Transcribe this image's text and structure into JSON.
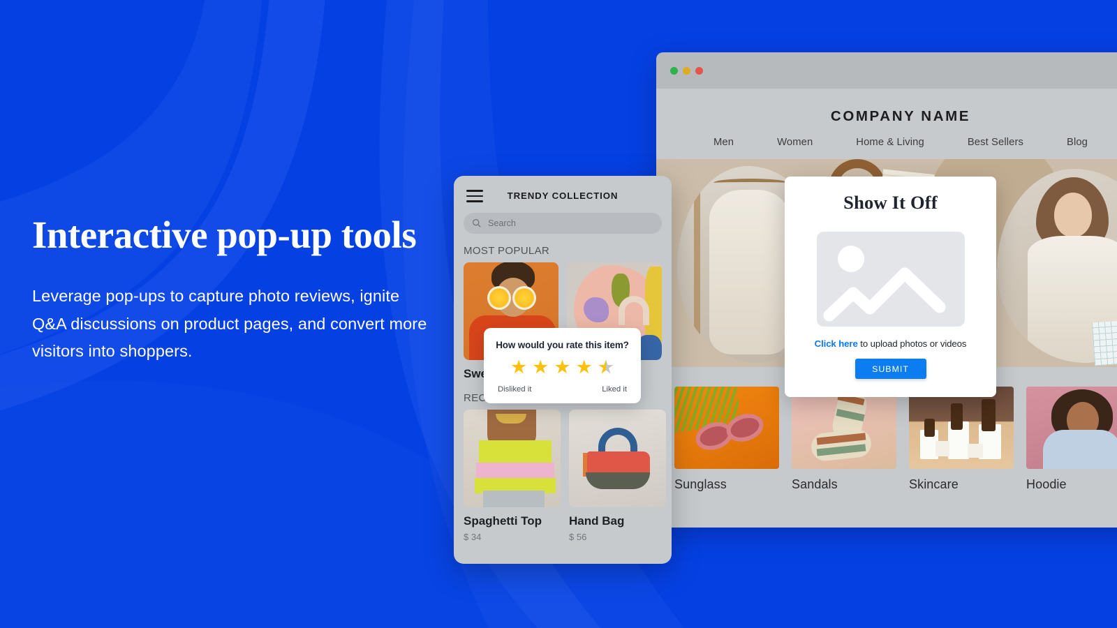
{
  "theme": {
    "brand_blue": "#0540E3",
    "accent_blue": "#0b7df0",
    "star_gold": "#FFC107",
    "mock_grey": "#c6cacd"
  },
  "hero": {
    "title": "Interactive pop-up tools",
    "subtitle": "Leverage pop-ups to capture photo reviews, ignite Q&A discussions on product pages, and convert more visitors into shoppers."
  },
  "browser": {
    "window_dots": [
      "green",
      "yellow",
      "red"
    ],
    "brand": "COMPANY NAME",
    "nav": [
      {
        "label": "Men"
      },
      {
        "label": "Women"
      },
      {
        "label": "Home & Living"
      },
      {
        "label": "Best Sellers"
      },
      {
        "label": "Blog"
      }
    ],
    "products": [
      {
        "name": "Sunglass"
      },
      {
        "name": "Sandals"
      },
      {
        "name": "Skincare"
      },
      {
        "name": "Hoodie"
      }
    ]
  },
  "phone": {
    "menu_icon": "hamburger-icon",
    "title": "TRENDY COLLECTION",
    "search": {
      "icon": "search-icon",
      "placeholder": "Search",
      "value": ""
    },
    "sections": [
      {
        "title": "MOST POPULAR"
      },
      {
        "title": "RECENTLY PURCHASED"
      }
    ],
    "popular_cut_name": "Swe",
    "recent_products": [
      {
        "name": "Spaghetti Top",
        "price": "$ 34"
      },
      {
        "name": "Hand Bag",
        "price": "$ 56"
      }
    ]
  },
  "rating_popup": {
    "question": "How would you rate this item?",
    "rating_value": 4.5,
    "max_stars": 5,
    "low_label": "Disliked it",
    "high_label": "Liked it"
  },
  "upload_popup": {
    "title": "Show It Off",
    "dropzone_icon": "image-placeholder-icon",
    "link_text": "Click here",
    "hint_text": " to upload photos or videos",
    "submit_label": "SUBMIT"
  }
}
